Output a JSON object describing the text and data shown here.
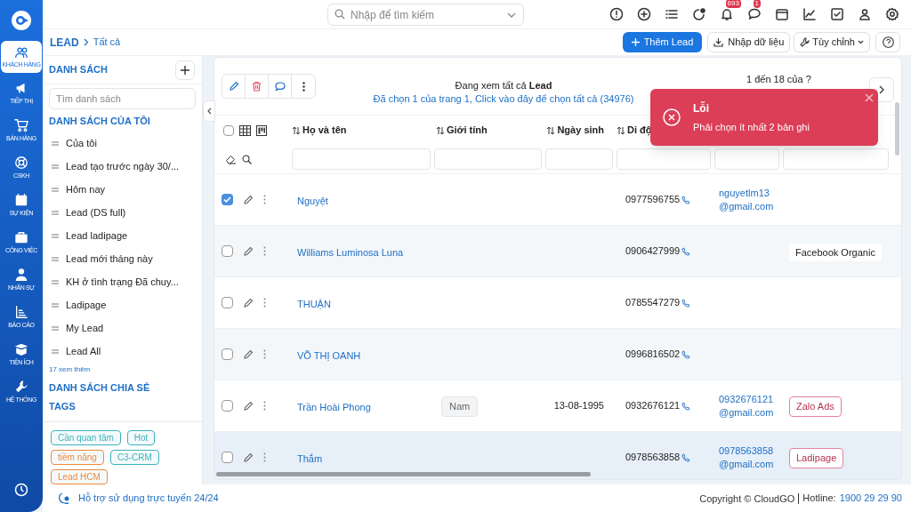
{
  "topbar": {
    "search_placeholder": "Nhập để tìm kiếm",
    "icons": [
      {
        "kind": "alert"
      },
      {
        "kind": "plus"
      },
      {
        "kind": "list"
      },
      {
        "kind": "dot"
      },
      {
        "kind": "bell",
        "badge": "693"
      },
      {
        "kind": "chat",
        "badge": "1"
      },
      {
        "kind": "calendar"
      },
      {
        "kind": "chart"
      },
      {
        "kind": "check"
      },
      {
        "kind": "user"
      },
      {
        "kind": "settings"
      }
    ]
  },
  "nav": [
    {
      "label": "KHÁCH HÀNG",
      "kind": "users",
      "selected": true
    },
    {
      "label": "TIẾP THỊ",
      "kind": "megaphone",
      "selected": false
    },
    {
      "label": "BÁN HÀNG",
      "kind": "cart",
      "selected": false
    },
    {
      "label": "CSKH",
      "kind": "lifebuoy",
      "selected": false
    },
    {
      "label": "SỰ KIỆN",
      "kind": "calendar",
      "selected": false
    },
    {
      "label": "CÔNG VIỆC",
      "kind": "briefcase",
      "selected": false
    },
    {
      "label": "NHÂN SỰ",
      "kind": "user",
      "selected": false
    },
    {
      "label": "BÁO CÁO",
      "kind": "chart",
      "selected": false
    },
    {
      "label": "TIỆN ÍCH",
      "kind": "box",
      "selected": false
    },
    {
      "label": "HỆ THỐNG",
      "kind": "wrench",
      "selected": false
    }
  ],
  "breadcrumb": [
    "LEAD",
    "Tất cả"
  ],
  "actions": [
    {
      "label": "Thêm Lead",
      "kind": "primary"
    },
    {
      "label": "Nhập dữ liệu",
      "kind": "import"
    },
    {
      "label": "Tùy chỉnh",
      "kind": "customize"
    },
    {
      "kind": "help"
    }
  ],
  "lists_panel": {
    "title": "DANH SÁCH",
    "search_placeholder": "Tìm danh sách",
    "my_lists_title": "DANH SÁCH CỦA TÔI",
    "my_lists": [
      "Của tôi",
      "Lead tạo trước ngày 30/...",
      "Hôm nay",
      "Lead (DS full)",
      "Lead ladipage",
      "Lead mới tháng này",
      "KH ở tình trạng Đã chuy...",
      "Ladipage",
      "My Lead",
      "Lead All"
    ],
    "more": "17 xem thêm",
    "shared_title": "DANH SÁCH CHIA SẺ",
    "tags_title": "TAGS",
    "tags": [
      {
        "label": "Cần quan tâm",
        "color": "#3bb3bd"
      },
      {
        "label": "Hot",
        "color": "#3bb3bd"
      },
      {
        "label": "tiềm năng",
        "color": "#f0883a"
      },
      {
        "label": "C3-CRM",
        "color": "#3bb3bd"
      },
      {
        "label": "Lead HCM",
        "color": "#f0883a"
      }
    ]
  },
  "table": {
    "viewing": "Đang xem tất cả **Lead**",
    "selection_note": "Đã chọn 1 của trang 1, Click vào đây để chọn tất cả (34976)",
    "pagination": "1 đến 18 của ?",
    "select_all": {
      "checked": false
    },
    "columns": [
      "Họ và tên",
      "Giới tính",
      "Ngày sinh",
      "Di độ"
    ],
    "rows": [
      {
        "checked": true,
        "hovered": false,
        "name": "Nguyệt",
        "phone": "0977596755",
        "email": "nguyetlm13@gmail.com"
      },
      {
        "checked": false,
        "hovered": false,
        "name": "Williams Luminosa Luna",
        "phone": "0906427999",
        "source": {
          "label": "Facebook Organic",
          "kind": "plain"
        }
      },
      {
        "checked": false,
        "hovered": false,
        "name": "THUẬN",
        "phone": "0785547279"
      },
      {
        "checked": false,
        "hovered": false,
        "name": "VÕ THỊ OANH",
        "phone": "0996816502"
      },
      {
        "checked": false,
        "hovered": false,
        "name": "Trần Hoài Phong",
        "gender": "Nam",
        "birthday": "13-08-1995",
        "phone": "0932676121",
        "email": "0932676121@gmail.com",
        "source": {
          "label": "Zalo Ads",
          "kind": "tag"
        }
      },
      {
        "checked": false,
        "name": "Thắm",
        "phone": "0978563858",
        "email": "0978563858@gmail.com",
        "source": {
          "label": "Ladipage",
          "kind": "tag"
        },
        "hovered": true
      }
    ]
  },
  "toast": {
    "title": "Lỗi",
    "message": "Phải chọn ít nhất 2 bản ghi"
  },
  "footer": {
    "support": "Hỗ trợ sử dụng trực tuyến 24/24",
    "copyright": "Copyright © CloudGO",
    "hotline_label": "Hotline:",
    "hotline": "1900 29 29 90"
  }
}
